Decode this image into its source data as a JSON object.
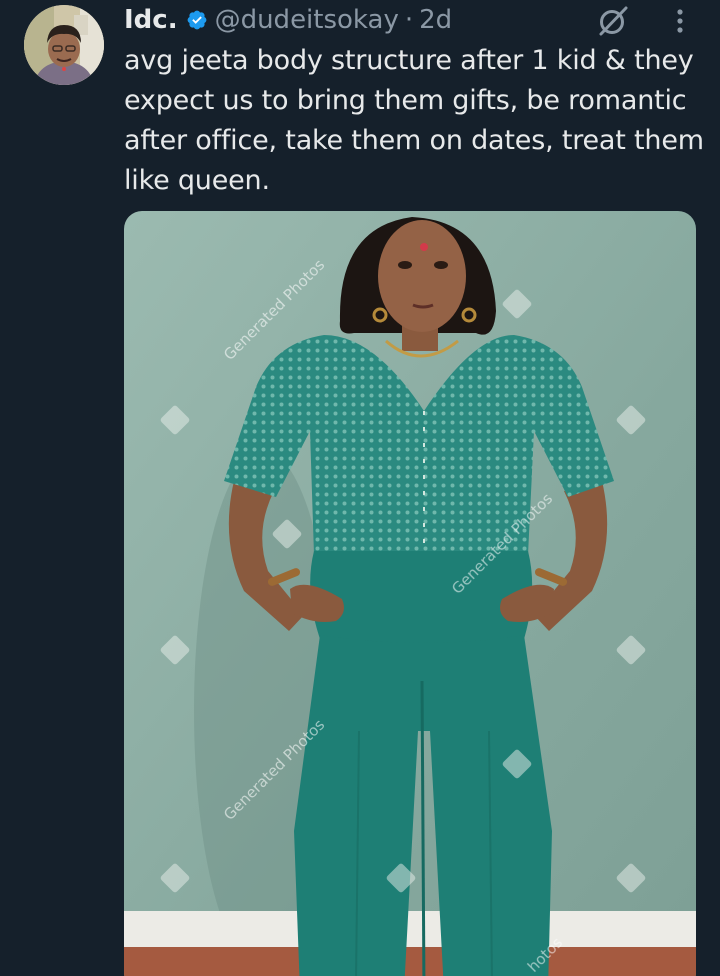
{
  "tweet": {
    "author_name": "Idc.",
    "handle": "@dudeitsokay",
    "separator": "·",
    "time": "2d",
    "text": "avg jeeta body structure after 1 kid & they expect us to bring them gifts, be romantic after office, take them on dates, treat them like queen.",
    "verified": true
  },
  "media": {
    "watermark": "Generated Photos",
    "watermark_partial": "hotos",
    "colors": {
      "wall": "#8fb0a6",
      "outfit": "#1e7f75",
      "floor": "#a55a40"
    }
  },
  "icons": {
    "verified": "verified-badge-icon",
    "grok": "grok-icon",
    "more": "more-options-icon"
  },
  "colors": {
    "background": "#15202b",
    "text_primary": "#e7e9ea",
    "text_secondary": "#8b98a5",
    "accent": "#1d9bf0"
  }
}
